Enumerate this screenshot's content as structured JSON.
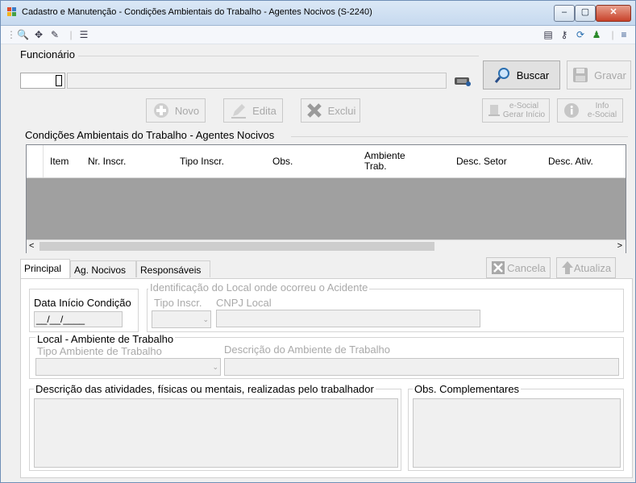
{
  "window": {
    "title": "Cadastro e Manutenção - Condições Ambientais do Trabalho - Agentes Nocivos (S-2240)",
    "min_label": "–",
    "max_label": "▢",
    "close_label": "✕"
  },
  "funcionario": {
    "group_label": "Funcionário",
    "buscar_label": "Buscar",
    "gravar_label": "Gravar"
  },
  "actions": {
    "novo_label": "Novo",
    "edita_label": "Edita",
    "exclui_label": "Exclui",
    "esocial_gerar_line1": "e-Social",
    "esocial_gerar_line2": "Gerar Início",
    "info_esocial_line1": "Info",
    "info_esocial_line2": "e-Social"
  },
  "grid": {
    "group_label": "Condições Ambientais do Trabalho - Agentes Nocivos",
    "columns": [
      {
        "label": "Item"
      },
      {
        "label": "Nr. Inscr."
      },
      {
        "label": "Tipo Inscr."
      },
      {
        "label": "Obs."
      },
      {
        "label": "Ambiente Trab."
      },
      {
        "label": "Desc. Setor"
      },
      {
        "label": "Desc. Ativ."
      }
    ],
    "scroll_left": "<",
    "scroll_right": ">"
  },
  "tabs": [
    {
      "label": "Principal",
      "active": true
    },
    {
      "label": "Ag. Nocivos",
      "active": false
    },
    {
      "label": "Responsáveis",
      "active": false
    }
  ],
  "tab_buttons": {
    "cancela_label": "Cancela",
    "atualiza_label": "Atualiza"
  },
  "principal": {
    "data_inicio_label": "Data Início Condição",
    "data_inicio_value": "__/__/____",
    "identificacao_label": "Identificação do Local onde ocorreu o Acidente",
    "tipo_inscr_label": "Tipo Inscr.",
    "cnpj_local_label": "CNPJ Local",
    "local_ambiente_label": "Local - Ambiente de Trabalho",
    "tipo_ambiente_label": "Tipo Ambiente de Trabalho",
    "descricao_ambiente_label": "Descrição do Ambiente de Trabalho",
    "descricao_atividades_label": "Descrição das atividades, físicas ou mentais, realizadas pelo trabalhador",
    "obs_complementares_label": "Obs. Complementares"
  }
}
